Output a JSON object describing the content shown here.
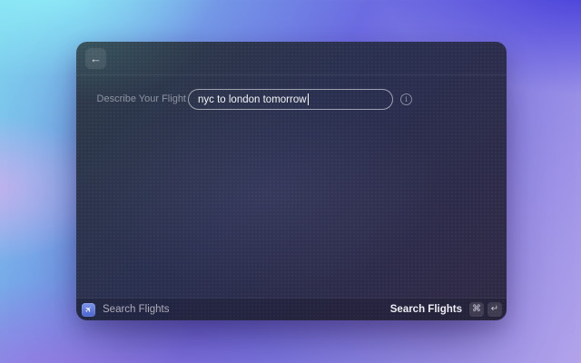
{
  "window": {
    "header": {
      "back_icon": "←"
    },
    "form": {
      "label": "Describe Your Flight",
      "value": "nyc to london tomorrow",
      "info_glyph": "i"
    },
    "footer": {
      "plane_glyph": "✈",
      "command_title": "Search Flights",
      "action_label": "Search Flights",
      "key_cmd": "⌘",
      "key_return": "↵"
    },
    "colors": {
      "accent_blue": "#5270dd",
      "window_bg_top_left": "#2e3b48",
      "window_bg_bottom": "#2e2a45",
      "backdrop_cyan": "#8feef8",
      "backdrop_blue": "#3b33d8",
      "backdrop_purple": "#9a77e2",
      "backdrop_lavender": "#b2a3ea"
    }
  }
}
